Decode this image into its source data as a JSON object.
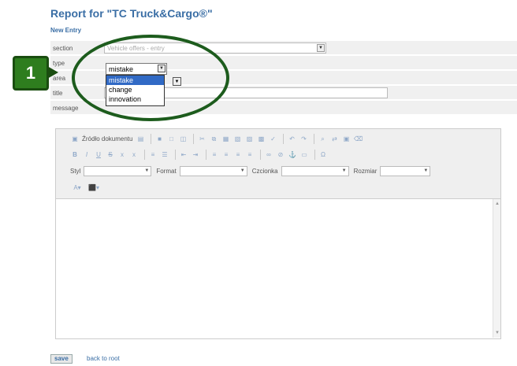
{
  "page": {
    "title": "Report for \"TC Truck&Cargo®\"",
    "subtitle": "New Entry"
  },
  "form": {
    "section_label": "section",
    "section_value": "Vehicle offers - entry",
    "type_label": "type",
    "area_label": "area",
    "title_label": "title",
    "message_label": "message"
  },
  "type_dropdown": {
    "selected": "mistake",
    "options": [
      "mistake",
      "change",
      "innovation"
    ]
  },
  "editor": {
    "source_button": "Źródło dokumentu",
    "style_label": "Styl",
    "format_label": "Format",
    "font_label": "Czcionka",
    "size_label": "Rozmiar"
  },
  "footer": {
    "save_label": "save",
    "back_link": "back to root"
  },
  "callout": {
    "step_number": "1",
    "color": "#2e7d1e"
  }
}
